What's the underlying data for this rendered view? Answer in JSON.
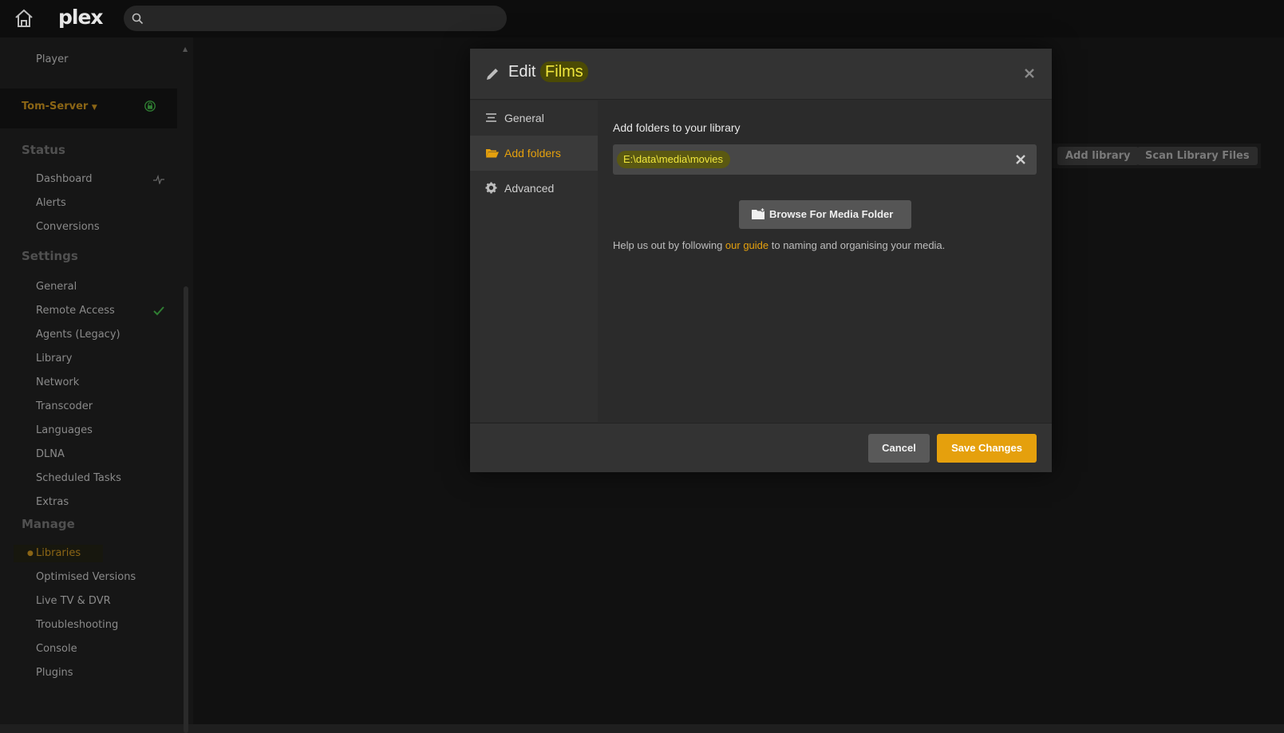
{
  "app": {
    "logo_text": "plex",
    "brand_color": "#e5a00d"
  },
  "search": {
    "placeholder": ""
  },
  "sidebar": {
    "player_label": "Player",
    "server_name": "Tom-Server",
    "status_heading": "Status",
    "status_items": [
      "Dashboard",
      "Alerts",
      "Conversions"
    ],
    "settings_heading": "Settings",
    "settings_items": [
      "General",
      "Remote Access",
      "Agents (Legacy)",
      "Library",
      "Network",
      "Transcoder",
      "Languages",
      "DLNA",
      "Scheduled Tasks",
      "Extras"
    ],
    "manage_heading": "Manage",
    "manage_items": [
      "Libraries",
      "Optimised Versions",
      "Live TV & DVR",
      "Troubleshooting",
      "Console",
      "Plugins"
    ],
    "active_item": "Libraries"
  },
  "background": {
    "add_library_label": "Add library",
    "scan_library_label": "Scan Library Files"
  },
  "modal": {
    "title_prefix": "Edit",
    "title_name": "Films",
    "nav": [
      {
        "label": "General",
        "icon": "list-icon"
      },
      {
        "label": "Add folders",
        "icon": "folder-open-icon",
        "active": true
      },
      {
        "label": "Advanced",
        "icon": "gear-icon"
      }
    ],
    "section_label": "Add folders to your library",
    "folder_path": "E:\\data\\media\\movies",
    "browse_label": "Browse For Media Folder",
    "help_prefix": "Help us out by following ",
    "help_link": "our guide",
    "help_suffix": " to naming and organising your media.",
    "cancel_label": "Cancel",
    "save_label": "Save Changes"
  }
}
